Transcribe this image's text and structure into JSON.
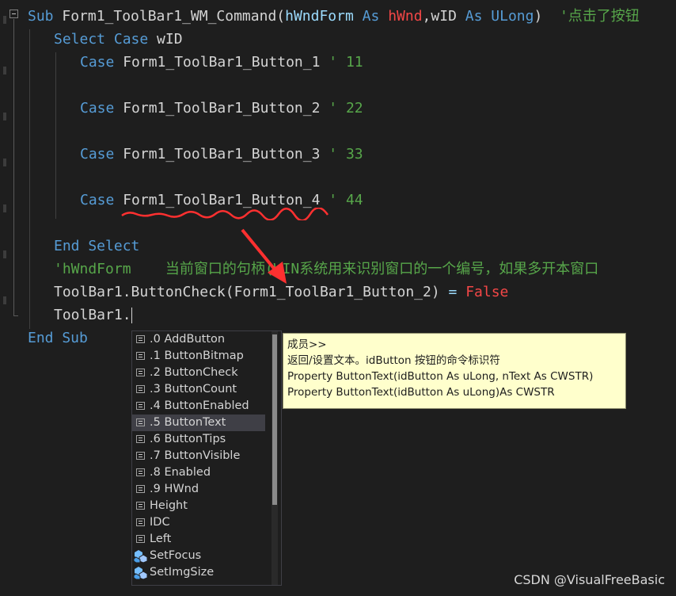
{
  "code": {
    "line1": {
      "kw_sub": "Sub",
      "name": " Form1_ToolBar1_WM_Command(",
      "p1": "hWndForm",
      "as1": " As ",
      "t1": "hWnd",
      "comma": ",",
      "p2": "wID",
      "as2": " As ",
      "t2": "ULong",
      "close": ")",
      "comment": "  '点击了按钮"
    },
    "line2": {
      "kw": "Select Case",
      "rest": " wID"
    },
    "case1": {
      "kw": "Case",
      "name": " Form1_ToolBar1_Button_1",
      "cm": " ' 11"
    },
    "case2": {
      "kw": "Case",
      "name": " Form1_ToolBar1_Button_2",
      "cm": " ' 22"
    },
    "case3": {
      "kw": "Case",
      "name": " Form1_ToolBar1_Button_3",
      "cm": " ' 33"
    },
    "case4": {
      "kw": "Case",
      "name": " Form1_ToolBar1_Button_4",
      "cm": " ' 44"
    },
    "end_select": "End Select",
    "comment_line": "'hWndForm    当前窗口的句柄(WIN系统用来识别窗口的一个编号，如果多开本窗口",
    "line_buttoncheck": {
      "obj": "ToolBar1.ButtonCheck(",
      "arg": "Form1_ToolBar1_Button_2",
      "mid": ") ",
      "eq": "=",
      "sp": " ",
      "val": "False"
    },
    "line_typing": "ToolBar1.",
    "end_sub": "End Sub"
  },
  "completion": {
    "items": [
      {
        "label": ".0 AddButton",
        "icon": "property-icon"
      },
      {
        "label": ".1 ButtonBitmap",
        "icon": "property-icon"
      },
      {
        "label": ".2 ButtonCheck",
        "icon": "property-icon"
      },
      {
        "label": ".3 ButtonCount",
        "icon": "property-icon"
      },
      {
        "label": ".4 ButtonEnabled",
        "icon": "property-icon"
      },
      {
        "label": ".5 ButtonText",
        "icon": "property-icon"
      },
      {
        "label": ".6 ButtonTips",
        "icon": "property-icon"
      },
      {
        "label": ".7 ButtonVisible",
        "icon": "property-icon"
      },
      {
        "label": ".8 Enabled",
        "icon": "property-icon"
      },
      {
        "label": ".9 HWnd",
        "icon": "property-icon"
      },
      {
        "label": "Height",
        "icon": "property-icon"
      },
      {
        "label": "IDC",
        "icon": "property-icon"
      },
      {
        "label": "Left",
        "icon": "property-icon"
      },
      {
        "label": "SetFocus",
        "icon": "method-icon"
      },
      {
        "label": "SetImgSize",
        "icon": "method-icon"
      }
    ],
    "selected_index": 5
  },
  "tooltip": {
    "line1": "成员>>",
    "line2": "返回/设置文本。idButton 按钮的命令标识符",
    "line3": "Property ButtonText(idButton As uLong, nText As CWSTR)",
    "line4": "Property ButtonText(idButton As uLong)As CWSTR"
  },
  "watermark": "CSDN @VisualFreeBasic",
  "colors": {
    "background": "#1e1e1e",
    "keyword": "#569cd6",
    "comment": "#57a64a",
    "false": "#f44747",
    "tooltip_bg": "#ffffcc",
    "annotation": "#ff3030"
  }
}
